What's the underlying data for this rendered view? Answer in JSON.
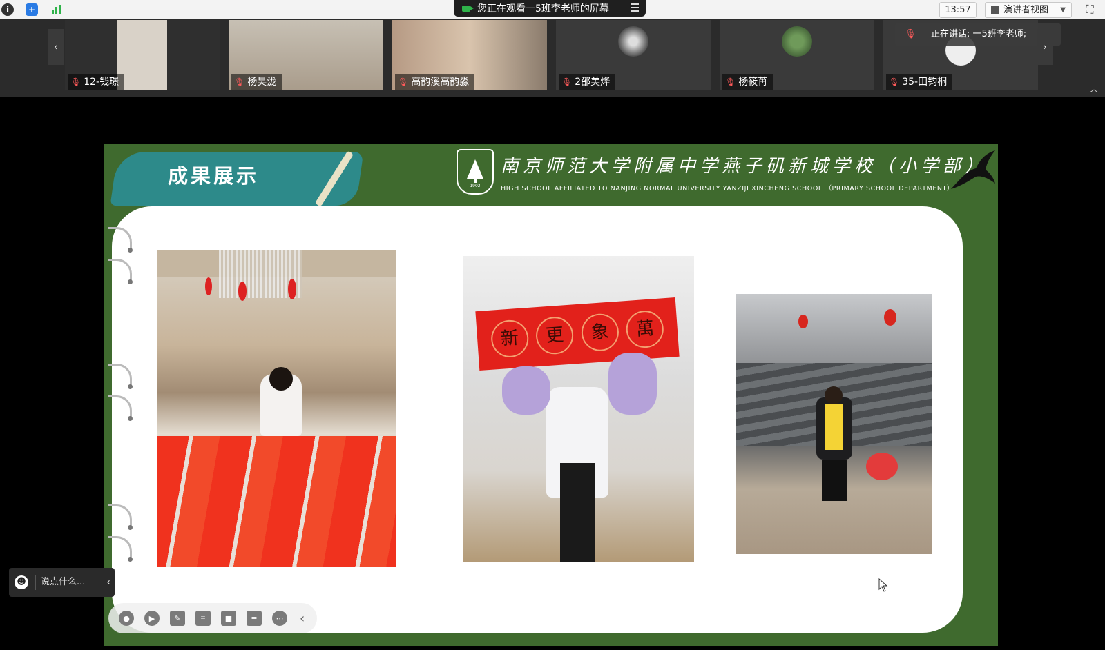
{
  "topbar": {
    "info_icon": "info-icon",
    "shield_icon": "shield-icon",
    "stats_icon": "bar-chart-icon",
    "watching_text": "您正在观看一5班李老师的屏幕",
    "time": "13:57",
    "view_button": "演讲者视图"
  },
  "participants": [
    {
      "name": "12-钱璟",
      "color": "#6e5a4a"
    },
    {
      "name": "杨昊泷",
      "color": "#8a7a64"
    },
    {
      "name": "高韵溪高韵淼",
      "color": "#75685c"
    },
    {
      "name": "2邵美烨",
      "color": "#3a3a3a"
    },
    {
      "name": "杨筱苒",
      "color": "#3a3a3a"
    },
    {
      "name": "35-田钧桐",
      "color": "#3a3a3a"
    }
  ],
  "speaking": "正在讲话: 一5班李老师;",
  "slide": {
    "title": "成果展示",
    "school_cn": "南京师范大学附属中学燕子矶新城学校（小学部）",
    "school_en": "HIGH SCHOOL AFFILIATED TO NANJING NORMAL UNIVERSITY YANZIJI XINCHENG SCHOOL （PRIMARY SCHOOL DEPARTMENT）",
    "logo_year": "1902",
    "banner_chars": [
      "新",
      "更",
      "象",
      "萬"
    ]
  },
  "chat": {
    "placeholder": "说点什么..."
  }
}
